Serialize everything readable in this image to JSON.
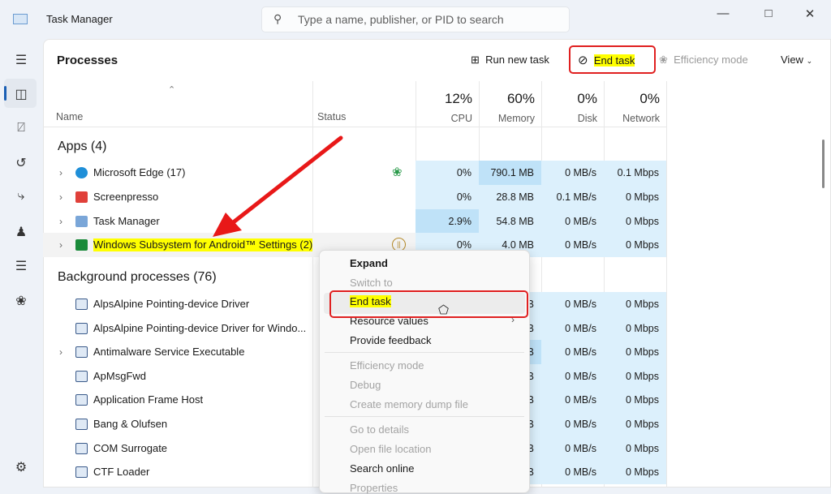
{
  "window": {
    "title": "Task Manager",
    "search_placeholder": "Type a name, publisher, or PID to search"
  },
  "header": {
    "title": "Processes",
    "run_new_task": "Run new task",
    "end_task": "End task",
    "efficiency_mode": "Efficiency mode",
    "view": "View"
  },
  "columns": {
    "name": "Name",
    "status": "Status",
    "cpu": {
      "pct": "12%",
      "label": "CPU"
    },
    "memory": {
      "pct": "60%",
      "label": "Memory"
    },
    "disk": {
      "pct": "0%",
      "label": "Disk"
    },
    "network": {
      "pct": "0%",
      "label": "Network"
    }
  },
  "groups": {
    "apps": "Apps (4)",
    "background": "Background processes (76)"
  },
  "apps": [
    {
      "name": "Microsoft Edge (17)",
      "cpu": "0%",
      "memory": "790.1 MB",
      "disk": "0 MB/s",
      "network": "0.1 Mbps",
      "icon": "edge-icon",
      "color": "#1f8fd8"
    },
    {
      "name": "Screenpresso",
      "cpu": "0%",
      "memory": "28.8 MB",
      "disk": "0.1 MB/s",
      "network": "0 Mbps",
      "icon": "screenpresso-icon",
      "color": "#e0403a"
    },
    {
      "name": "Task Manager",
      "cpu": "2.9%",
      "memory": "54.8 MB",
      "disk": "0 MB/s",
      "network": "0 Mbps",
      "icon": "task-manager-icon",
      "color": "#7aa6d8"
    },
    {
      "name": "Windows Subsystem for Android™ Settings (2)",
      "cpu": "0%",
      "memory": "4.0 MB",
      "disk": "0 MB/s",
      "network": "0 Mbps",
      "icon": "android-icon",
      "color": "#1a8a3a"
    }
  ],
  "background": [
    {
      "name": "AlpsAlpine Pointing-device Driver",
      "memory": "B",
      "disk": "0 MB/s",
      "network": "0 Mbps",
      "expand": false
    },
    {
      "name": "AlpsAlpine Pointing-device Driver for Windo...",
      "memory": "B",
      "disk": "0 MB/s",
      "network": "0 Mbps",
      "expand": false
    },
    {
      "name": "Antimalware Service Executable",
      "memory": "B",
      "disk": "0 MB/s",
      "network": "0 Mbps",
      "expand": true
    },
    {
      "name": "ApMsgFwd",
      "memory": "B",
      "disk": "0 MB/s",
      "network": "0 Mbps",
      "expand": false
    },
    {
      "name": "Application Frame Host",
      "memory": "B",
      "disk": "0 MB/s",
      "network": "0 Mbps",
      "expand": false
    },
    {
      "name": "Bang & Olufsen",
      "memory": "B",
      "disk": "0 MB/s",
      "network": "0 Mbps",
      "expand": false
    },
    {
      "name": "COM Surrogate",
      "memory": "B",
      "disk": "0 MB/s",
      "network": "0 Mbps",
      "expand": false
    },
    {
      "name": "CTF Loader",
      "memory": "B",
      "disk": "0 MB/s",
      "network": "0 Mbps",
      "expand": false
    }
  ],
  "context_menu": {
    "expand": "Expand",
    "switch_to": "Switch to",
    "end_task": "End task",
    "resource_values": "Resource values",
    "provide_feedback": "Provide feedback",
    "efficiency_mode": "Efficiency mode",
    "debug": "Debug",
    "create_dump": "Create memory dump file",
    "go_to_details": "Go to details",
    "open_file_location": "Open file location",
    "search_online": "Search online",
    "properties": "Properties"
  }
}
